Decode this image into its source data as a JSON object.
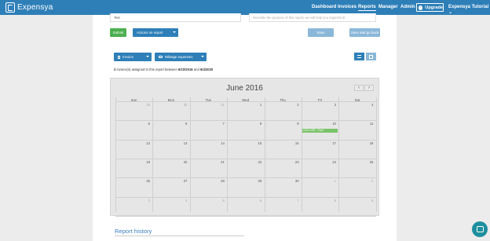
{
  "brand": {
    "name": "Expensya"
  },
  "nav": {
    "dashboard": "Dashboard",
    "invoices": "Invoices",
    "reports": "Reports",
    "manager": "Manager",
    "admin": "Admin",
    "upgrade": "Upgrade",
    "tutorial": "Expensya Tutorial"
  },
  "form": {
    "title_value": "Test",
    "purpose_placeholder": "Describe the purpose of this report; we will help you organize it!"
  },
  "actions": {
    "submit": "Submit",
    "actions_on_report": "Actions on report",
    "save": "Save",
    "save_go_back": "Save and go back"
  },
  "filters": {
    "invoice": "Invoice",
    "mileage": "Mileage expenses"
  },
  "summary": {
    "count": "2",
    "text": "invoice(s) assigned to this report between",
    "from": "6/10/2016",
    "and": "and",
    "to": "6/4/2020"
  },
  "calendar": {
    "title": "June 2016",
    "prev": "‹",
    "next": "›",
    "weekdays": [
      "Sun",
      "Mon",
      "Tue",
      "Wed",
      "Thu",
      "Fri",
      "Sat"
    ],
    "weeks": [
      [
        "29",
        "30",
        "31",
        "1",
        "2",
        "3",
        "4"
      ],
      [
        "5",
        "6",
        "7",
        "8",
        "9",
        "10",
        "11"
      ],
      [
        "12",
        "13",
        "14",
        "15",
        "16",
        "17",
        "18"
      ],
      [
        "19",
        "20",
        "21",
        "22",
        "23",
        "24",
        "25"
      ],
      [
        "26",
        "27",
        "28",
        "29",
        "30",
        "1",
        "2"
      ],
      [
        "3",
        "4",
        "5",
        "6",
        "7",
        "8",
        "9"
      ]
    ],
    "event": "4:00 USD - Fuel"
  },
  "history": {
    "title": "Report history"
  },
  "colors": {
    "brand": "#2e7fb8",
    "submit": "#4caf50",
    "event": "#7bc46a"
  }
}
